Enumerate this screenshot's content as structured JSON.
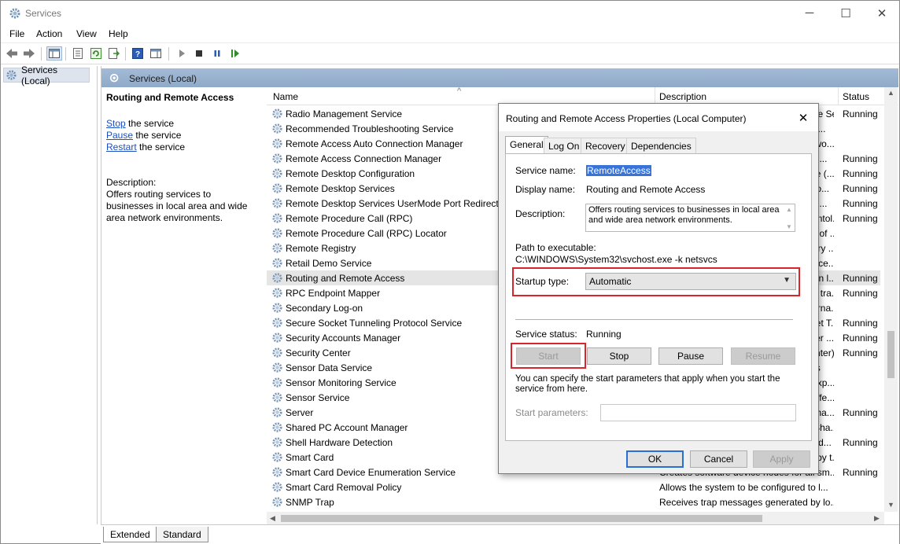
{
  "window": {
    "title": "Services"
  },
  "menu": [
    "File",
    "Action",
    "View",
    "Help"
  ],
  "tree": {
    "root": "Services (Local)"
  },
  "pane": {
    "header": "Services (Local)"
  },
  "extended": {
    "title": "Routing and Remote Access",
    "actions": [
      {
        "link": "Stop",
        "rest": " the service"
      },
      {
        "link": "Pause",
        "rest": " the service"
      },
      {
        "link": "Restart",
        "rest": " the service"
      }
    ],
    "desc_label": "Description:",
    "desc_text": "Offers routing services to businesses in local area and wide area network environments."
  },
  "list": {
    "columns": {
      "name": "Name",
      "description": "Description",
      "status": "Status"
    },
    "rows": [
      {
        "name": "Radio Management Service",
        "desc": "Radio Management and Airplane Mode Se...",
        "status": "Running"
      },
      {
        "name": "Recommended Troubleshooting Service",
        "desc": "Enables automatic mitigation for know...",
        "status": ""
      },
      {
        "name": "Remote Access Auto Connection Manager",
        "desc": "Creates a connection to a remote netwo...",
        "status": ""
      },
      {
        "name": "Remote Access Connection Manager",
        "desc": "Manages dial-up and virtual private ne...",
        "status": "Running"
      },
      {
        "name": "Remote Desktop Configuration",
        "desc": "Remote Desktop Configuration service (...",
        "status": "Running"
      },
      {
        "name": "Remote Desktop Services",
        "desc": "Allows users to connect interactively to...",
        "status": "Running"
      },
      {
        "name": "Remote Desktop Services UserMode Port Redirector",
        "desc": "Allows the redirection of Printers/Drive...",
        "status": "Running"
      },
      {
        "name": "Remote Procedure Call (RPC)",
        "desc": "The RPCSS service is the Service Contol...",
        "status": "Running"
      },
      {
        "name": "Remote Procedure Call (RPC) Locator",
        "desc": "In Windows 2003 and earlier versions of ...",
        "status": ""
      },
      {
        "name": "Remote Registry",
        "desc": "Enables remote users to modify registry ...",
        "status": ""
      },
      {
        "name": "Retail Demo Service",
        "desc": "The Retail Demo service controls device...",
        "status": ""
      },
      {
        "name": "Routing and Remote Access",
        "desc": "Offers routing services to businesses in l...",
        "status": "Running",
        "selected": true
      },
      {
        "name": "RPC Endpoint Mapper",
        "desc": "Resolves RPC interfaces identifiers to tra...",
        "status": "Running"
      },
      {
        "name": "Secondary Log-on",
        "desc": "Enables starting processes under alterna...",
        "status": ""
      },
      {
        "name": "Secure Socket Tunneling Protocol Service",
        "desc": "Provides support for the Secure Socket T...",
        "status": "Running"
      },
      {
        "name": "Security Accounts Manager",
        "desc": "The startup of this service signals other ...",
        "status": "Running"
      },
      {
        "name": "Security Center",
        "desc": "The WSCSVC (Windows Security Center)...",
        "status": "Running"
      },
      {
        "name": "Sensor Data Service",
        "desc": "Delivers data from a variety of sensors",
        "status": ""
      },
      {
        "name": "Sensor Monitoring Service",
        "desc": "Monitors various sensors in order to exp...",
        "status": ""
      },
      {
        "name": "Sensor Service",
        "desc": "A service for sensors that manages diffe...",
        "status": ""
      },
      {
        "name": "Server",
        "desc": "Supports file, print, and named-pipe sha...",
        "status": "Running"
      },
      {
        "name": "Shared PC Account Manager",
        "desc": "Manages profiles and accounts on a Sha...",
        "status": ""
      },
      {
        "name": "Shell Hardware Detection",
        "desc": "Provides notifications for AutoPlay hard...",
        "status": "Running"
      },
      {
        "name": "Smart Card",
        "desc": "Manages access to smart cards read by t...",
        "status": ""
      },
      {
        "name": "Smart Card Device Enumeration Service",
        "desc": "Creates software device nodes for all sm...",
        "status": "Running"
      },
      {
        "name": "Smart Card Removal Policy",
        "desc": "Allows the system to be configured to l...",
        "status": ""
      },
      {
        "name": "SNMP Trap",
        "desc": "Receives trap messages generated by lo...",
        "status": ""
      }
    ]
  },
  "tabs": [
    "Extended",
    "Standard"
  ],
  "dialog": {
    "title": "Routing and Remote Access Properties (Local Computer)",
    "tabs": [
      "General",
      "Log On",
      "Recovery",
      "Dependencies"
    ],
    "service_name_label": "Service name:",
    "service_name": "RemoteAccess",
    "display_name_label": "Display name:",
    "display_name": "Routing and Remote Access",
    "description_label": "Description:",
    "description": "Offers routing services to businesses in local area and wide area network environments.",
    "path_label": "Path to executable:",
    "path": "C:\\WINDOWS\\System32\\svchost.exe -k netsvcs",
    "startup_label": "Startup type:",
    "startup_value": "Automatic",
    "status_label": "Service status:",
    "status_value": "Running",
    "buttons": {
      "start": "Start",
      "stop": "Stop",
      "pause": "Pause",
      "resume": "Resume"
    },
    "hint": "You can specify the start parameters that apply when you start the service from here.",
    "params_label": "Start parameters:",
    "ok": "OK",
    "cancel": "Cancel",
    "apply": "Apply"
  },
  "colors": {
    "highlight": "#d8242a",
    "link": "#1a4ec2",
    "header": "#8fa9c8"
  }
}
